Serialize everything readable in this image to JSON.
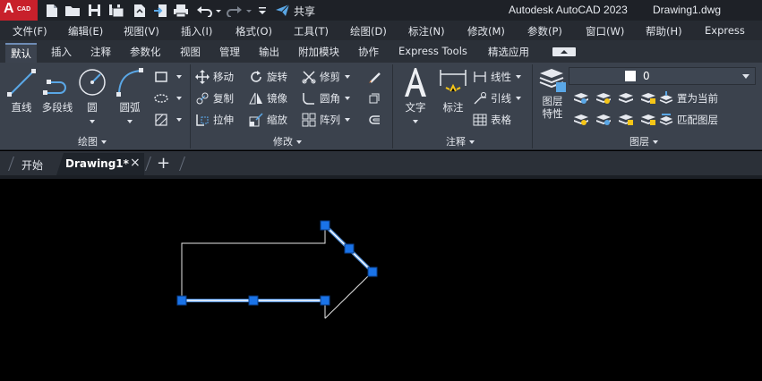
{
  "app": {
    "logo_letter": "A",
    "logo_suffix": "CAD",
    "share_label": "共享",
    "title": "Autodesk AutoCAD 2023",
    "document": "Drawing1.dwg"
  },
  "menus": [
    "文件(F)",
    "编辑(E)",
    "视图(V)",
    "插入(I)",
    "格式(O)",
    "工具(T)",
    "绘图(D)",
    "标注(N)",
    "修改(M)",
    "参数(P)",
    "窗口(W)",
    "帮助(H)",
    "Express"
  ],
  "ribbon_tabs": [
    "默认",
    "插入",
    "注释",
    "参数化",
    "视图",
    "管理",
    "输出",
    "附加模块",
    "协作",
    "Express Tools",
    "精选应用"
  ],
  "active_tab": "默认",
  "panels": {
    "draw": {
      "title": "绘图",
      "tools": [
        "直线",
        "多段线",
        "圆",
        "圆弧"
      ]
    },
    "modify": {
      "title": "修改",
      "tools": [
        "移动",
        "旋转",
        "修剪",
        "复制",
        "镜像",
        "圆角",
        "拉伸",
        "缩放",
        "阵列"
      ]
    },
    "annotation": {
      "title": "注释",
      "big_tools": [
        "文字",
        "标注"
      ],
      "small_tools": [
        "线性",
        "引线",
        "表格"
      ]
    },
    "layers": {
      "title": "图层",
      "big_tool": [
        "图层",
        "特性"
      ],
      "current_layer": "0",
      "actions": [
        "置为当前",
        "匹配图层"
      ]
    }
  },
  "file_tabs": {
    "start": "开始",
    "drawing": "Drawing1*",
    "close_glyph": "×",
    "new_glyph": "+"
  },
  "colors": {
    "grip": "#1a73e8",
    "selection_line": "#4e8dd8",
    "entity": "#e6e6e6",
    "logo": "#c8202b"
  }
}
